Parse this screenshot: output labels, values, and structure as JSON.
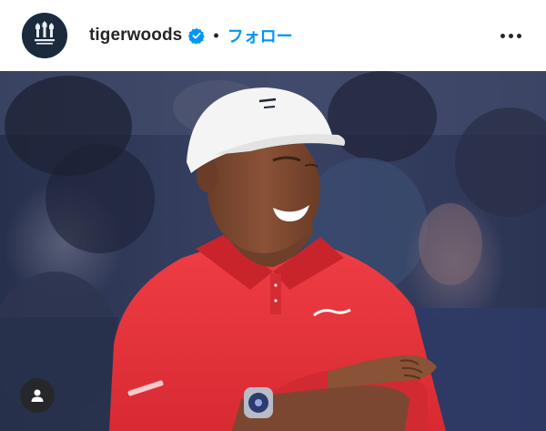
{
  "post": {
    "username": "tigerwoods",
    "separator": "•",
    "follow_label": "フォロー",
    "verified": true
  },
  "icons": {
    "avatar": "tgr-logo-avatar",
    "verified": "verified-badge-icon",
    "more": "more-options-icon",
    "tag": "user-tag-icon"
  },
  "colors": {
    "follow": "#0095f6",
    "verified": "#0095f6",
    "shirt": "#e8323a",
    "cap": "#f4f4f4"
  }
}
